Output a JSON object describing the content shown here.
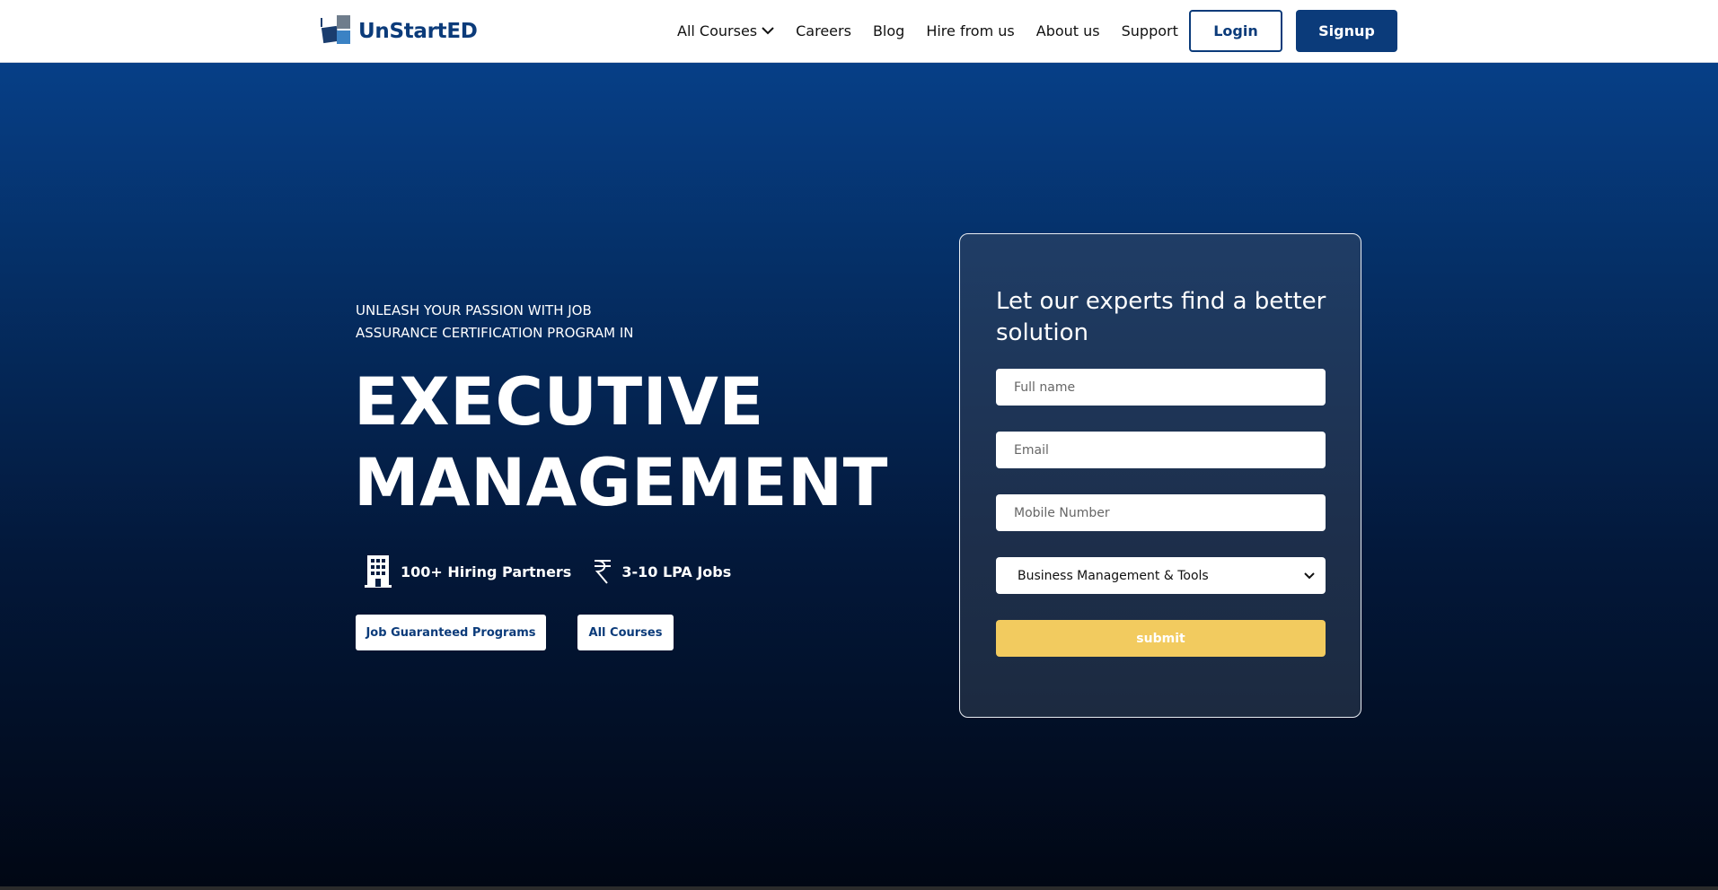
{
  "brand": {
    "name": "UnStartED",
    "logo_icon": "unstarted-logo-icon",
    "color": "#0b3b7a"
  },
  "nav": {
    "items": [
      {
        "label": "All Courses",
        "icon": "chevron-down-icon"
      },
      {
        "label": "Careers"
      },
      {
        "label": "Blog"
      },
      {
        "label": "Hire from us"
      },
      {
        "label": "About us"
      },
      {
        "label": "Support"
      }
    ],
    "login_label": "Login",
    "signup_label": "Signup"
  },
  "hero": {
    "tagline": "UNLEASH YOUR PASSION WITH JOB ASSURANCE CERTIFICATION PROGRAM IN",
    "headline_line1": "EXECUTIVE",
    "headline_line2": "MANAGEMENT",
    "stats": [
      {
        "icon": "building-icon",
        "text": "100+ Hiring Partners"
      },
      {
        "icon": "rupee-icon",
        "text": "3-10 LPA Jobs"
      }
    ],
    "buttons": {
      "job_guaranteed": "Job Guaranteed Programs",
      "all_courses": "All Courses"
    }
  },
  "form": {
    "title": "Let our experts find a better solution",
    "full_name_placeholder": "Full name",
    "email_placeholder": "Email",
    "mobile_placeholder": "Mobile Number",
    "course_selected": "Business Management & Tools",
    "submit_label": "submit",
    "submit_color": "#f2cb5f"
  }
}
